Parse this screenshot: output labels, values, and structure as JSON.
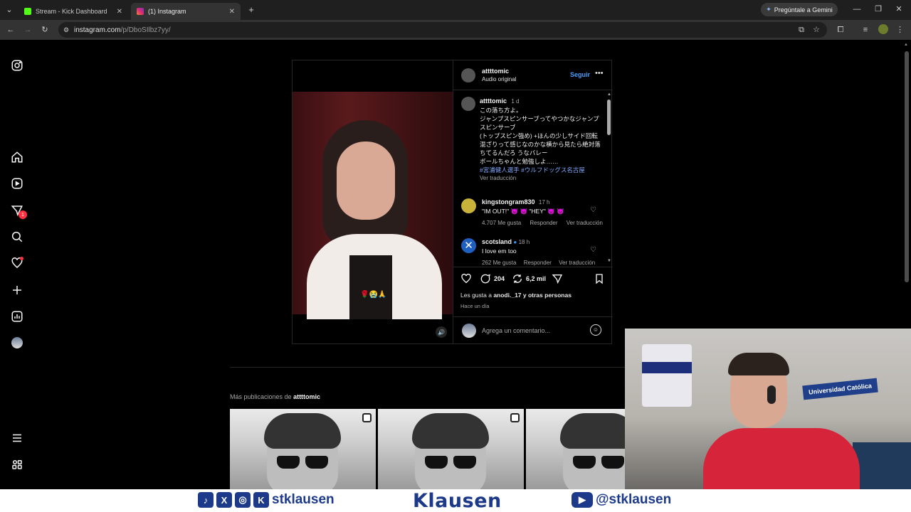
{
  "browser": {
    "tabs": [
      {
        "label": "Stream - Kick Dashboard",
        "icon": "kick-icon",
        "color": "#53fc18"
      },
      {
        "label": "(1) Instagram",
        "icon": "instagram-icon",
        "color": "#e1306c"
      }
    ],
    "url_domain": "instagram.com",
    "url_path": "/p/DboSIlbz7yy/",
    "gemini_label": "Pregúntale a Gemini"
  },
  "sidebar": {
    "notifications_badge": "1"
  },
  "post": {
    "author": "attttomic",
    "audio": "Audio original",
    "follow_label": "Seguir",
    "caption": {
      "username": "attttomic",
      "time": "1 d",
      "lines": [
        "この落ち方よ。",
        "ジャンプスピンサーブってやつかなジャンプスピンサーブ",
        "(トップスピン強め) +ほんの少しサイド回転混ざりって感じなのかな横から見たら絶対落ちてるんだろ うなバレー",
        "ボールちゃんと勉強しよ……"
      ],
      "tags": "#宮浦健人選手 #ウルフドッグス名古屋",
      "translate": "Ver traducción"
    },
    "comments": [
      {
        "username": "kingstongram830",
        "time": "17 h",
        "text": "\"IM OUT!\" 👿 👿 \"HEY\" 👿 👿",
        "likes": "4.707 Me gusta",
        "reply": "Responder",
        "translate": "Ver traducción"
      },
      {
        "username": "scotsland",
        "time": "18 h",
        "text": "I love em too",
        "likes": "262 Me gusta",
        "reply": "Responder",
        "translate": "Ver traducción"
      }
    ],
    "comment_count": "204",
    "repost_count": "6,2 mil",
    "likes_prefix": "Les gusta a ",
    "likes_user": "anodi._17",
    "likes_suffix": " y otras personas",
    "date": "Hace un día",
    "add_comment_placeholder": "Agrega un comentario..."
  },
  "more_posts": {
    "prefix": "Más publicaciones de ",
    "user": "attttomic"
  },
  "webcam": {
    "banner_text": "Universidad Católica"
  },
  "footer": {
    "left_handle": "stklausen",
    "brand": "Klausen",
    "right_handle": "@stklausen"
  }
}
